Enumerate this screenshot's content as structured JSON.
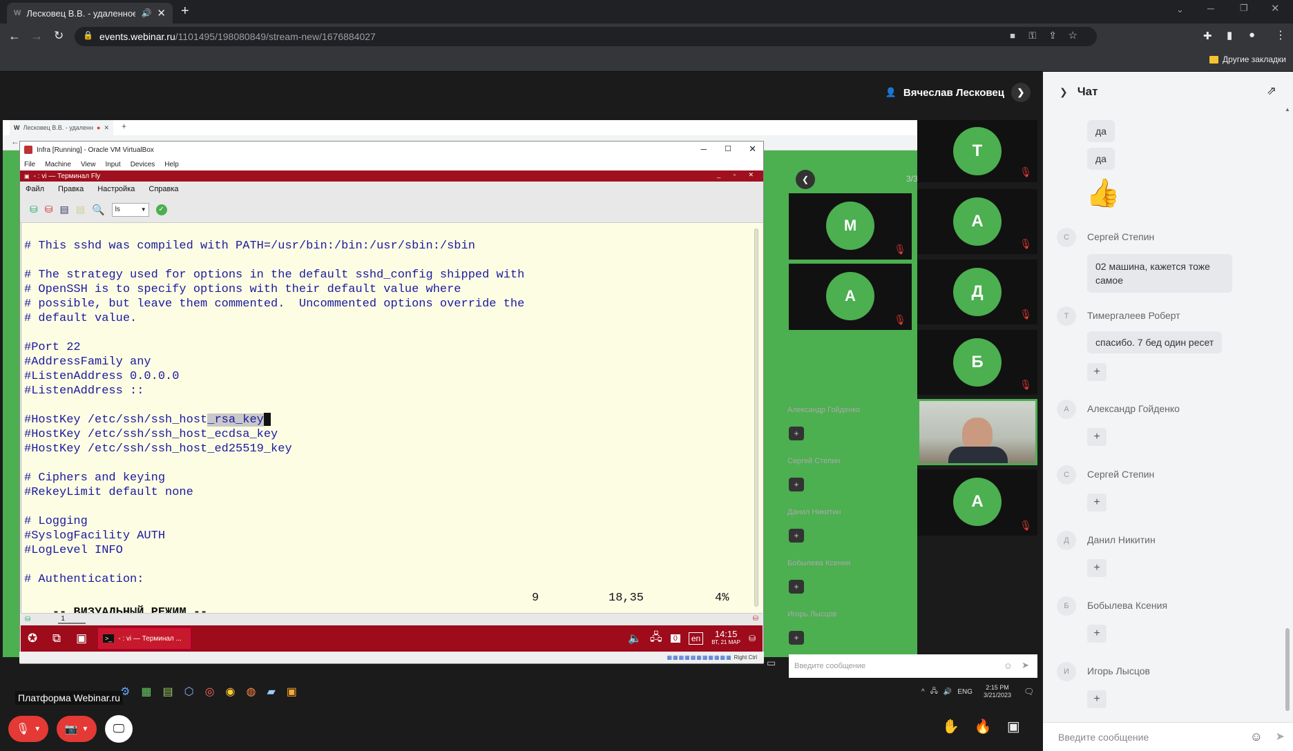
{
  "browser": {
    "tab_title": "Лесковец В.В. - удаленное",
    "url_host": "events.webinar.ru",
    "url_path": "/1101495/198080849/stream-new/1676884027",
    "bookmarks_label": "Другие закладки"
  },
  "webinar": {
    "presenter_name": "Вячеслав Лесковец",
    "page_counter": "3/3",
    "platform_label": "Платформа Webinar.ru",
    "participants": [
      {
        "initial": "T"
      },
      {
        "initial": "M"
      },
      {
        "initial": "A"
      },
      {
        "initial": "A"
      },
      {
        "initial": "Д"
      },
      {
        "initial": "Б"
      },
      {
        "initial": "A"
      }
    ],
    "side_names": [
      "Александр Гойденко",
      "Сергей Степин",
      "Данил Никитин",
      "Бобылева Ксения",
      "Игорь Лысцов"
    ],
    "inner_chat_placeholder": "Введите сообщение"
  },
  "shared_screen": {
    "inner_tab_title": "Лесковец В.В. - удаленное",
    "vbox_title": "Infra [Running] - Oracle VM VirtualBox",
    "vbox_menu": [
      "File",
      "Machine",
      "View",
      "Input",
      "Devices",
      "Help"
    ],
    "terminal_title": "- : vi — Терминал Fly",
    "terminal_menu": [
      "Файл",
      "Правка",
      "Настройка",
      "Справка"
    ],
    "combo_value": "ls",
    "code_lines": [
      "# This sshd was compiled with PATH=/usr/bin:/bin:/usr/sbin:/sbin",
      "",
      "# The strategy used for options in the default sshd_config shipped with",
      "# OpenSSH is to specify options with their default value where",
      "# possible, but leave them commented.  Uncommented options override the",
      "# default value.",
      "",
      "#Port 22",
      "#AddressFamily any",
      "#ListenAddress 0.0.0.0",
      "#ListenAddress ::",
      "",
      "#HostKey /etc/ssh/ssh_host",
      "#HostKey /etc/ssh/ssh_host_ecdsa_key",
      "#HostKey /etc/ssh/ssh_host_ed25519_key",
      "",
      "# Ciphers and keying",
      "#RekeyLimit default none",
      "",
      "# Logging",
      "#SyslogFacility AUTH",
      "#LogLevel INFO",
      "",
      "# Authentication:"
    ],
    "selected_text": "_rsa_key",
    "status_mode": "-- ВИЗУАЛЬНЫЙ РЕЖИМ --",
    "status_count": "9",
    "status_pos": "18,35",
    "status_pct": "4%",
    "term_tab": "1",
    "taskbar_item": "- : vi — Терминал ...",
    "guest_lang": "en",
    "guest_time": "14:15",
    "guest_date": "ВТ, 21 МАР",
    "badge": "0",
    "right_ctrl": "Right Ctrl",
    "host_lang": "ENG",
    "host_time": "2:15 PM",
    "host_date": "3/21/2023"
  },
  "chat": {
    "title": "Чат",
    "messages": [
      {
        "type": "bubble",
        "text": "да"
      },
      {
        "type": "bubble",
        "text": "да"
      },
      {
        "type": "emoji",
        "text": "👍"
      },
      {
        "type": "author",
        "initial": "С",
        "name": "Сергей Степин"
      },
      {
        "type": "bubble",
        "text": "02 машина, кажется тоже самое"
      },
      {
        "type": "author",
        "initial": "Т",
        "name": "Тимергалеев Роберт"
      },
      {
        "type": "bubble",
        "text": "спасибо. 7 бед один ресет"
      },
      {
        "type": "plus",
        "text": "+"
      },
      {
        "type": "author",
        "initial": "А",
        "name": "Александр Гойденко"
      },
      {
        "type": "plus",
        "text": "+"
      },
      {
        "type": "author",
        "initial": "С",
        "name": "Сергей Степин"
      },
      {
        "type": "plus",
        "text": "+"
      },
      {
        "type": "author",
        "initial": "Д",
        "name": "Данил Никитин"
      },
      {
        "type": "plus",
        "text": "+"
      },
      {
        "type": "author",
        "initial": "Б",
        "name": "Бобылева Ксения"
      },
      {
        "type": "plus",
        "text": "+"
      },
      {
        "type": "author",
        "initial": "И",
        "name": "Игорь Лысцов"
      },
      {
        "type": "plus",
        "text": "+"
      }
    ],
    "input_placeholder": "Введите сообщение"
  },
  "colors": {
    "accent_green": "#4caf50",
    "terminal_bg": "#fdfde4",
    "terminal_text": "#1a1aa0",
    "fly_red": "#a0101e"
  }
}
